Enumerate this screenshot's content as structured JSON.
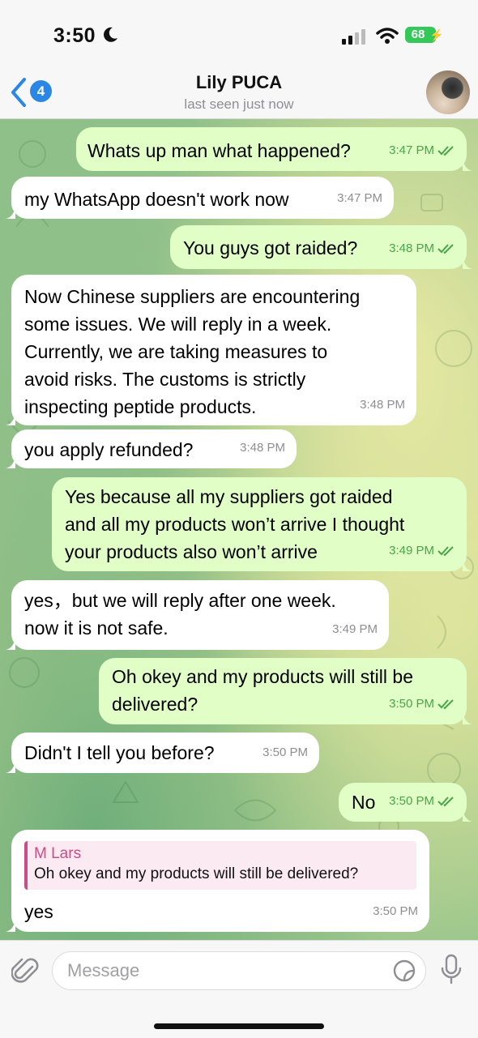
{
  "status_bar": {
    "time": "3:50",
    "battery": "68"
  },
  "header": {
    "unread_count": "4",
    "name": "Lily PUCA",
    "status": "last seen just now"
  },
  "messages": [
    {
      "dir": "out",
      "text": "Whats up man what happened?",
      "time": "3:47 PM"
    },
    {
      "dir": "in",
      "text": "my WhatsApp doesn't work now",
      "time": "3:47 PM"
    },
    {
      "dir": "out",
      "text": "You guys got raided?",
      "time": "3:48 PM"
    },
    {
      "dir": "in",
      "text": "Now Chinese suppliers are encountering\nsome issues. We will reply in a week.\nCurrently, we are taking measures to\navoid risks. The customs is strictly\ninspecting peptide products.",
      "time": "3:48 PM"
    },
    {
      "dir": "in",
      "text": "you apply refunded?",
      "time": "3:48 PM"
    },
    {
      "dir": "out",
      "text": "Yes because all my suppliers got raided\nand all my products won’t arrive I thought\nyour products also won’t arrive",
      "time": "3:49 PM"
    },
    {
      "dir": "in",
      "text": "yes，but we will reply after one week.\nnow it is not safe.",
      "time": "3:49 PM"
    },
    {
      "dir": "out",
      "text": "Oh okey and my products will still be\ndelivered?",
      "time": "3:50 PM"
    },
    {
      "dir": "in",
      "text": "Didn't I tell you before?",
      "time": "3:50 PM"
    },
    {
      "dir": "out",
      "text": "No",
      "time": "3:50 PM"
    },
    {
      "dir": "in",
      "text": "yes",
      "time": "3:50 PM",
      "reply": {
        "author": "M Lars",
        "text": "Oh okey and my products will still be delivered?"
      }
    }
  ],
  "input": {
    "placeholder": "Message"
  },
  "colors": {
    "outgoing_bubble": "#e1fec6",
    "incoming_bubble": "#ffffff",
    "accent": "#2a87e4",
    "check": "#4aa44a",
    "reply_accent": "#c94d86"
  },
  "icons": [
    "moon-icon",
    "signal-icon",
    "wifi-icon",
    "battery-icon",
    "back-chevron-icon",
    "attach-icon",
    "sticker-icon",
    "microphone-icon",
    "double-check-icon"
  ]
}
